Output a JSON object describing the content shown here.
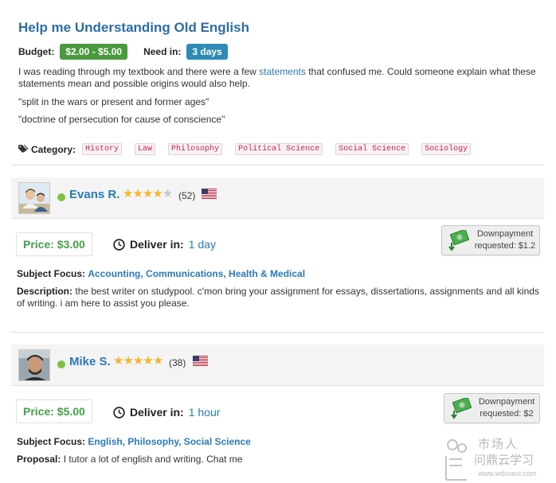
{
  "question": {
    "title": "Help me Understanding Old English",
    "budget_label": "Budget:",
    "budget_value": "$2.00 - $5.00",
    "need_in_label": "Need in:",
    "need_in_value": "3 days",
    "text_before": "I was reading through my textbook and there were a few ",
    "text_link": "statements",
    "text_after": " that confused me. Could someone explain what these statements mean and possible origins would also help.",
    "quote1": "\"split in the wars or present and former ages\"",
    "quote2": "\"doctrine of persecution for cause of conscience\"",
    "category_label": "Category:",
    "categories": [
      "History",
      "Law",
      "Philosophy",
      "Political Science",
      "Social Science",
      "Sociology"
    ]
  },
  "bids": [
    {
      "name": "Evans R.",
      "rating": 4,
      "max_rating": 5,
      "reviews": "(52)",
      "price": "Price: $3.00",
      "deliver_label": "Deliver in:",
      "deliver_value": "1 day",
      "downpayment_line1": "Downpayment",
      "downpayment_line2": "requested: $1.2",
      "focus_label": "Subject Focus:",
      "focus_value": "Accounting, Communications, Health & Medical",
      "text_label": "Description:",
      "text_value": "the best writer on studypool. c'mon bring your assignment for essays, dissertations, assignments and all kinds of writing. i am here to assist you please."
    },
    {
      "name": "Mike S.",
      "rating": 5,
      "max_rating": 5,
      "reviews": "(38)",
      "price": "Price: $5.00",
      "deliver_label": "Deliver in:",
      "deliver_value": "1 hour",
      "downpayment_line1": "Downpayment",
      "downpayment_line2": "requested: $2",
      "focus_label": "Subject Focus:",
      "focus_value": "English, Philosophy, Social Science",
      "text_label": "Proposal:",
      "text_value": "I tutor a lot of english and writing. Chat me"
    }
  ],
  "icons": {
    "category": "tag-icon",
    "online": "online-dot-icon",
    "star": "star-icon",
    "flag": "us-flag-icon",
    "clock": "clock-icon",
    "downpayment": "money-down-icon"
  },
  "colors": {
    "title": "#2e6da4",
    "budget_badge": "#4a9a3e",
    "need_badge": "#2e8bb5",
    "price": "#43a047",
    "link": "#2a7ab8",
    "tag_text": "#c7254e"
  },
  "watermark": {
    "line1": "市场人",
    "line2": "问鼎云学习",
    "url": "www.wdxuexi.com"
  }
}
